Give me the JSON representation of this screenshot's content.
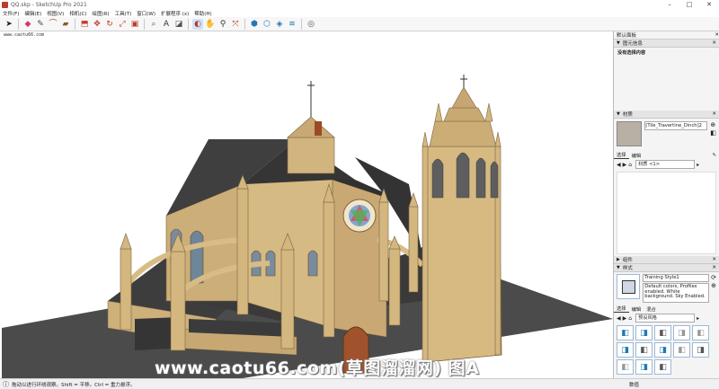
{
  "window": {
    "title": "QQ.skp - SketchUp Pro 2021"
  },
  "menu": [
    "文件(F)",
    "编辑(E)",
    "视图(V)",
    "相机(C)",
    "绘图(R)",
    "工具(T)",
    "窗口(W)",
    "扩展程序 (x)",
    "帮助(H)"
  ],
  "viewport": {
    "url_label": "www.caotu66.com",
    "watermark": "www.caotu66.com(草图溜溜网) 图A"
  },
  "tray": {
    "title": "默认面板",
    "entity_info": {
      "header": "图元信息",
      "content": "没有选择内容"
    },
    "materials": {
      "header": "材质",
      "material_name": "[Tile_Travertine_Dinch]2",
      "tab_select": "选择",
      "tab_edit": "编辑",
      "dropdown": "材质 <1>"
    },
    "components": {
      "header": "组件"
    },
    "styles": {
      "header": "样式",
      "style_name": "Training Style1",
      "description": "Default colors, Profiles enabled. White background. Sky Enabled.",
      "tab_select": "选择",
      "tab_edit": "编辑",
      "tab_mix": "混合",
      "dropdown": "预设风格"
    }
  },
  "statusbar": {
    "hint": "拖动以进行环绕观察。Shift = 平移。Ctrl = 重力悬浮。",
    "value_label": "数值"
  }
}
